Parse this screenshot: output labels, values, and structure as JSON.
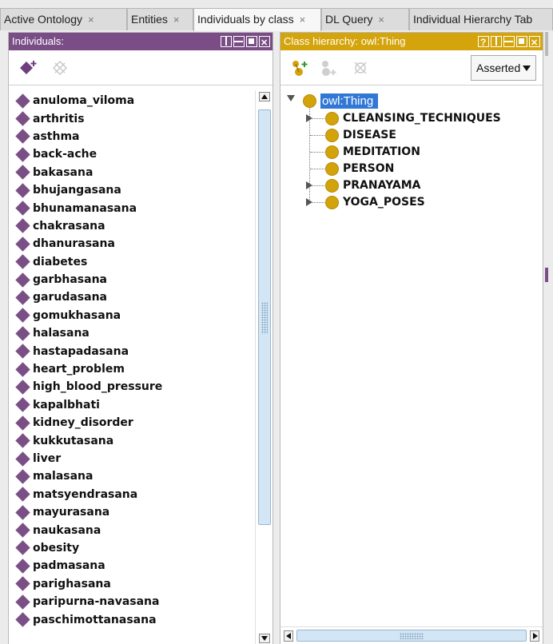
{
  "tabs": [
    {
      "label": "Active Ontology",
      "close": "×"
    },
    {
      "label": "Entities",
      "close": "×"
    },
    {
      "label": "Individuals by class",
      "close": "×"
    },
    {
      "label": "DL Query",
      "close": "×"
    },
    {
      "label": "Individual Hierarchy Tab",
      "close": ""
    }
  ],
  "individuals_panel": {
    "title": "Individuals:",
    "accent_color": "#7a4d86",
    "toolbar": {
      "add_icon": "add-individual-icon",
      "delete_icon": "delete-individual-icon"
    },
    "items": [
      "anuloma_viloma",
      "arthritis",
      "asthma",
      "back-ache",
      "bakasana",
      "bhujangasana",
      "bhunamanasana",
      "chakrasana",
      "dhanurasana",
      "diabetes",
      "garbhasana",
      "garudasana",
      "gomukhasana",
      "halasana",
      "hastapadasana",
      "heart_problem",
      "high_blood_pressure",
      "kapalbhati",
      "kidney_disorder",
      "kukkutasana",
      "liver",
      "malasana",
      "matsyendrasana",
      "mayurasana",
      "naukasana",
      "obesity",
      "padmasana",
      "parighasana",
      "paripurna-navasana",
      "paschimottanasana"
    ]
  },
  "class_panel": {
    "title": "Class hierarchy: owl:Thing",
    "accent_color": "#d4a40c",
    "mode_select": "Asserted",
    "root": "owl:Thing",
    "classes": [
      {
        "label": "CLEANSING_TECHNIQUES",
        "expandable": true
      },
      {
        "label": "DISEASE",
        "expandable": false
      },
      {
        "label": "MEDITATION",
        "expandable": false
      },
      {
        "label": "PERSON",
        "expandable": false
      },
      {
        "label": "PRANAYAMA",
        "expandable": true
      },
      {
        "label": "YOGA_POSES",
        "expandable": true
      }
    ]
  }
}
